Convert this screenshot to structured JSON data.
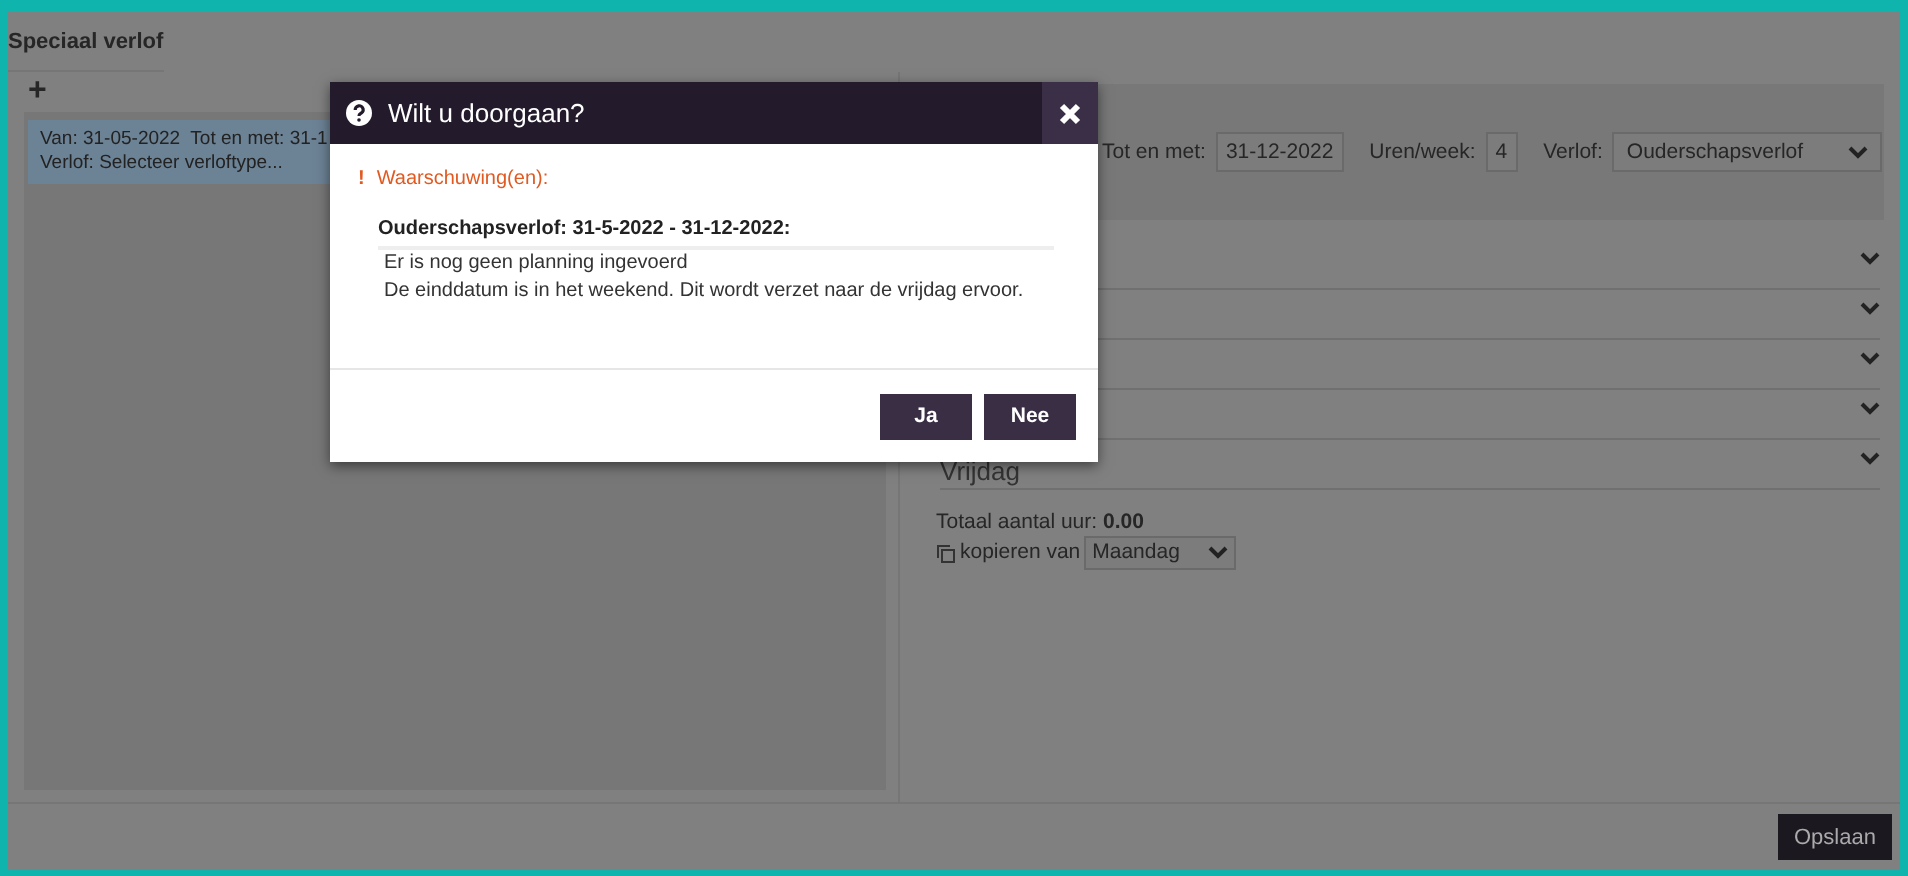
{
  "page": {
    "title": "Speciaal verlof",
    "add": "+",
    "items": [
      {
        "line1": "Van: 31-05-2022  Tot en met: 31-1",
        "line2": "Verlof: Selecteer verloftype...",
        "selected": true
      }
    ],
    "form": {
      "fields": [
        {
          "kind": "input",
          "label": "Tot en met:",
          "value": "31-12-2022"
        },
        {
          "kind": "input",
          "label": "Uren/week:",
          "value": "4"
        },
        {
          "kind": "select",
          "label": "Verlof:",
          "value": "Ouderschapsverlof"
        }
      ]
    },
    "days": [
      {
        "label": "Vrijdag"
      }
    ],
    "total_label": "Totaal aantal uur:",
    "total_value": "0.00",
    "copy_label": "kopieren van",
    "copy_value": "Maandag",
    "save": "Opslaan"
  },
  "dialog": {
    "title": "Wilt u doorgaan?",
    "warning_mark": "!",
    "warning": "Waarschuwing(en):",
    "heading": "Ouderschapsverlof: 31-5-2022 - 31-12-2022:",
    "messages": [
      "Er is nog geen planning ingevoerd",
      "De einddatum is in het weekend. Dit wordt verzet naar de vrijdag ervoor."
    ],
    "buttons": [
      "Ja",
      "Nee"
    ]
  }
}
